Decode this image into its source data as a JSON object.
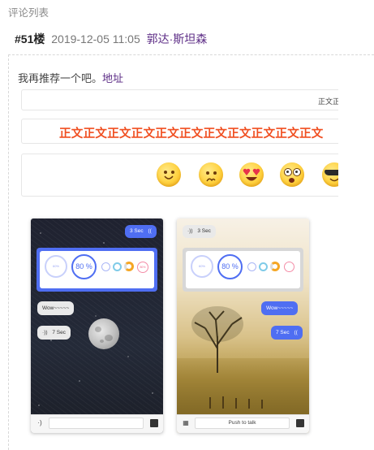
{
  "section_title": "评论列表",
  "comment": {
    "floor": "#51楼",
    "date": "2019-12-05 11:05",
    "author": "郭达·斯坦森",
    "text": "我再推荐一个吧。",
    "link_text": "地址"
  },
  "demo1_text": "正文正",
  "demo2_text": "正文正文正文正文正文正文正文正文正文正文正文",
  "emojis": [
    "smiling-face-icon",
    "worried-face-icon",
    "heart-eyes-face-icon",
    "shocked-face-icon",
    "sunglasses-face-icon"
  ],
  "phones": {
    "dark": {
      "bubble_top": "3 Sec",
      "progress_label": "80 %",
      "small_label": "80%",
      "bubble_wow": "Wow~~~~~",
      "bubble_voice": "7 Sec"
    },
    "light": {
      "bubble_top": "3 Sec",
      "progress_label": "80 %",
      "bubble_wow": "Wow~~~~~",
      "bubble_voice": "7 Sec",
      "push_to_talk": "Push to talk"
    }
  },
  "colors": {
    "accent_blue": "#4f6ef2",
    "emphasis_red": "#f04f21",
    "link_purple": "#5d2d86"
  }
}
